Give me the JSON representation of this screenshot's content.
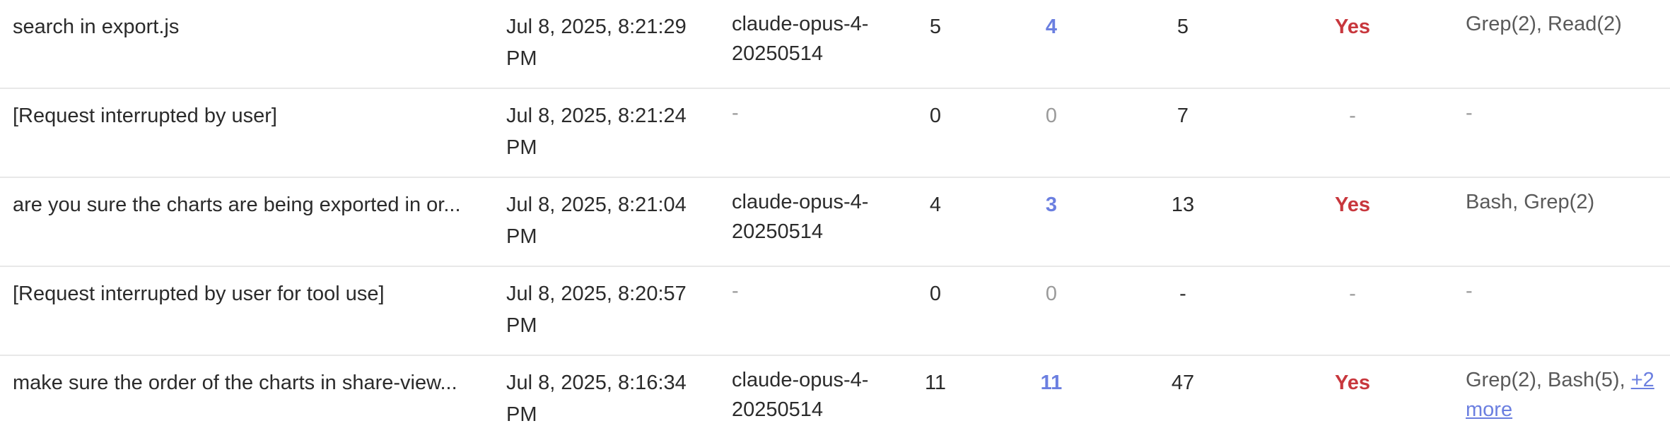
{
  "rows": [
    {
      "message": "search in export.js",
      "time": "Jul 8, 2025, 8:21:29 PM",
      "model": "claude-opus-4-20250514",
      "count1": "5",
      "count2": "4",
      "count3": "5",
      "status": "Yes",
      "tools": "Grep(2), Read(2)",
      "more": ""
    },
    {
      "message": "[Request interrupted by user]",
      "time": "Jul 8, 2025, 8:21:24 PM",
      "model": "-",
      "count1": "0",
      "count2": "0",
      "count3": "7",
      "status": "-",
      "tools": "-",
      "more": ""
    },
    {
      "message": "are you sure the charts are being exported in or...",
      "time": "Jul 8, 2025, 8:21:04 PM",
      "model": "claude-opus-4-20250514",
      "count1": "4",
      "count2": "3",
      "count3": "13",
      "status": "Yes",
      "tools": "Bash, Grep(2)",
      "more": ""
    },
    {
      "message": "[Request interrupted by user for tool use]",
      "time": "Jul 8, 2025, 8:20:57 PM",
      "model": "-",
      "count1": "0",
      "count2": "0",
      "count3": "-",
      "status": "-",
      "tools": "-",
      "more": ""
    },
    {
      "message": "make sure the order of the charts in share-view...",
      "time": "Jul 8, 2025, 8:16:34 PM",
      "model": "claude-opus-4-20250514",
      "count1": "11",
      "count2": "11",
      "count3": "47",
      "status": "Yes",
      "tools": "Grep(2), Bash(5),",
      "more": "+2 more"
    }
  ],
  "colors": {
    "accent": "#6b7fe0",
    "status_yes": "#c8373d",
    "muted": "#9a9a9a",
    "divider": "#e8e8e8"
  }
}
